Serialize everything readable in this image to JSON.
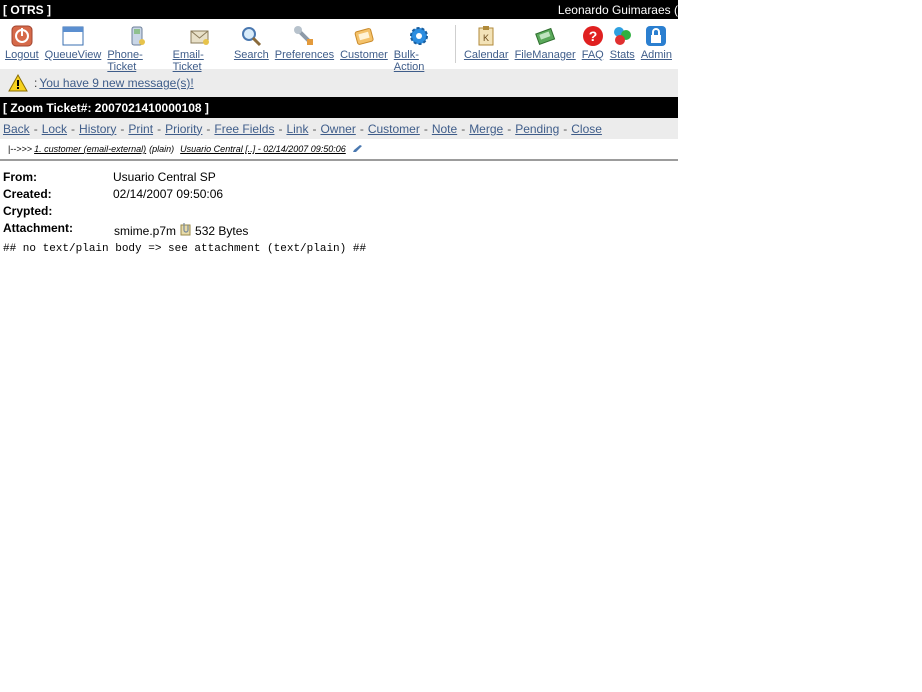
{
  "header": {
    "app_title": "[ OTRS ]",
    "user_name": "Leonardo Guimaraes ("
  },
  "nav": {
    "items": [
      {
        "label": "Logout",
        "icon": "power-icon"
      },
      {
        "label": "QueueView",
        "icon": "window-icon"
      },
      {
        "label": "Phone-Ticket",
        "icon": "phone-icon"
      },
      {
        "label": "Email-Ticket",
        "icon": "envelope-icon"
      },
      {
        "label": "Search",
        "icon": "magnifier-icon"
      },
      {
        "label": "Preferences",
        "icon": "wrench-icon"
      },
      {
        "label": "Customer",
        "icon": "address-book-icon"
      },
      {
        "label": "Bulk-Action",
        "icon": "gear-icon"
      },
      {
        "label": "Calendar",
        "icon": "calendar-icon"
      },
      {
        "label": "FileManager",
        "icon": "file-manager-icon"
      },
      {
        "label": "FAQ",
        "icon": "question-icon"
      },
      {
        "label": "Stats",
        "icon": "stats-icon"
      },
      {
        "label": "Admin",
        "icon": "lock-icon"
      }
    ]
  },
  "notification": {
    "prefix": ":",
    "link": "You have 9 new message(s)!"
  },
  "ticket": {
    "title": "[ Zoom Ticket#: 2007021410000108 ]"
  },
  "menu": {
    "back": "Back",
    "lock": "Lock",
    "history": "History",
    "print": "Print",
    "priority": "Priority",
    "free_fields": "Free Fields",
    "link": "Link",
    "owner": "Owner",
    "customer": "Customer",
    "note": "Note",
    "merge": "Merge",
    "pending": "Pending",
    "close": "Close",
    "separator": "-"
  },
  "tree": {
    "prefix": "|-->>>",
    "article_link": "1. customer (email-external)",
    "type": "(plain)",
    "summary": "Usuario Central [..] - 02/14/2007 09:50:06"
  },
  "article": {
    "from_label": "From:",
    "from_value": "Usuario Central SP",
    "created_label": "Created:",
    "created_value": "02/14/2007 09:50:06",
    "crypted_label": "Crypted:",
    "crypted_value": "",
    "attachment_label": "Attachment:",
    "attachment_name": "smime.p7m",
    "attachment_size": "532 Bytes",
    "body": "## no text/plain body => see attachment (text/plain) ##"
  }
}
